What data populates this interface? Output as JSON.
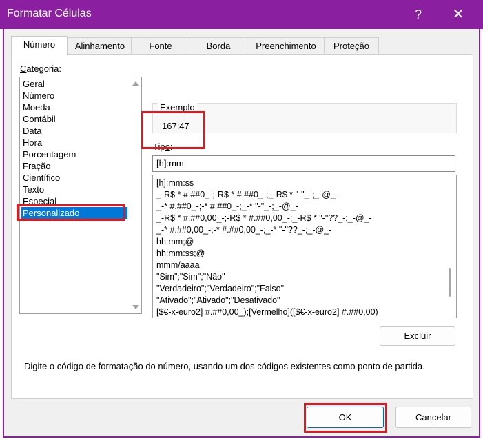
{
  "window": {
    "title": "Formatar Células",
    "help_glyph": "?",
    "close_glyph": "✕",
    "help_icon": "question-mark-icon",
    "close_icon": "close-icon",
    "accent_color": "#8a1fa0",
    "highlight_color": "#e0181f",
    "selection_color": "#0078d7"
  },
  "tabs": [
    {
      "label": "Número",
      "active": true
    },
    {
      "label": "Alinhamento",
      "active": false
    },
    {
      "label": "Fonte",
      "active": false
    },
    {
      "label": "Borda",
      "active": false
    },
    {
      "label": "Preenchimento",
      "active": false
    },
    {
      "label": "Proteção",
      "active": false
    }
  ],
  "category": {
    "label_first": "C",
    "label_rest": "ategoria:",
    "items": [
      "Geral",
      "Número",
      "Moeda",
      "Contábil",
      "Data",
      "Hora",
      "Porcentagem",
      "Fração",
      "Científico",
      "Texto",
      "Especial",
      "Personalizado"
    ],
    "selected": "Personalizado"
  },
  "example": {
    "title": "Exemplo",
    "value": "167:47"
  },
  "tipo": {
    "label_pre": "Tip",
    "label_under": "o",
    "label_post": ":",
    "value": "[h]:mm"
  },
  "formats": [
    "[h]:mm:ss",
    "_-R$ * #.##0_-;-R$ * #.##0_-;_-R$ * \"-\"_-;_-@_-",
    "_-* #.##0_-;-* #.##0_-;_-* \"-\"_-;_-@_-",
    "_-R$ * #.##0,00_-;-R$ * #.##0,00_-;_-R$ * \"-\"??_-;_-@_-",
    "_-* #.##0,00_-;-* #.##0,00_-;_-* \"-\"??_-;_-@_-",
    "hh:mm;@",
    "hh:mm:ss;@",
    "mmm/aaaa",
    "\"Sim\";\"Sim\";\"Não\"",
    "\"Verdadeiro\";\"Verdadeiro\";\"Falso\"",
    "\"Ativado\";\"Ativado\";\"Desativado\"",
    "[$€-x-euro2] #.##0,00_);[Vermelho]([$€-x-euro2] #.##0,00)"
  ],
  "buttons": {
    "excluir_first": "E",
    "excluir_rest": "xcluir",
    "ok": "OK",
    "cancel": "Cancelar"
  },
  "hint": "Digite o código de formatação do número, usando um dos códigos existentes como ponto de partida."
}
